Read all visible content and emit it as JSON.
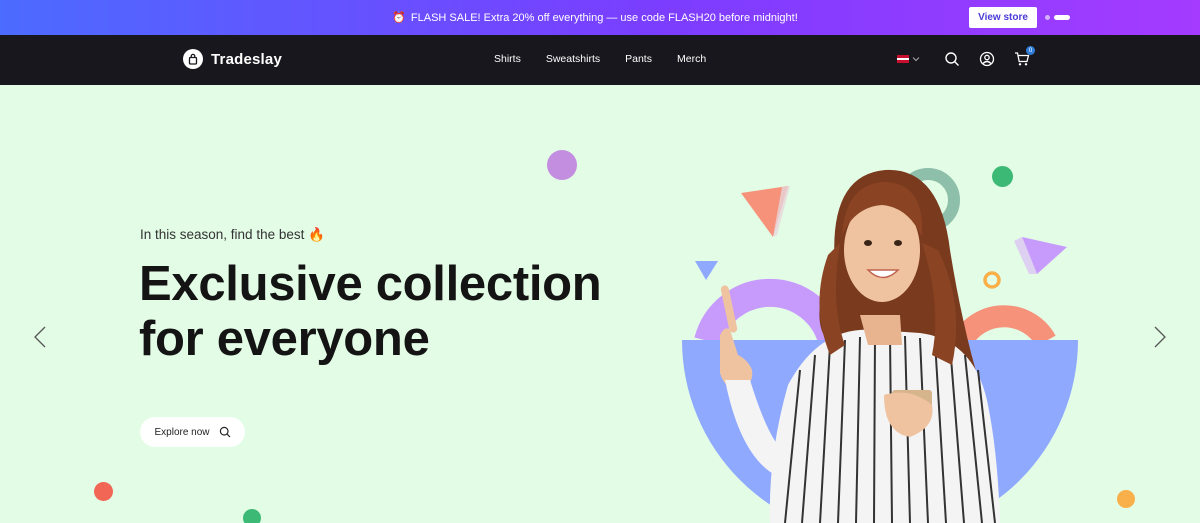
{
  "announcement": {
    "message": "FLASH SALE! Extra 20% off everything — use code FLASH20 before midnight!",
    "cta": "View store"
  },
  "header": {
    "brand": "Tradeslay",
    "nav": [
      "Shirts",
      "Sweatshirts",
      "Pants",
      "Merch"
    ],
    "cart_count": "0"
  },
  "hero": {
    "subtitle": "In this season, find the best 🔥",
    "headline_line1": "Exclusive collection",
    "headline_line2": "for everyone",
    "cta": "Explore now"
  },
  "colors": {
    "announcement_gradient_start": "#4c6bff",
    "announcement_gradient_end": "#a43bff",
    "header_bg": "#17171d",
    "hero_bg": "#e3fce6",
    "accent_blue": "#8fa9ff",
    "accent_purple": "#c79bfb",
    "accent_coral": "#f7927a",
    "accent_green": "#3cba75"
  },
  "icons": [
    "clock-icon",
    "logo-bag-icon",
    "flag-icon",
    "chevron-down-icon",
    "search-icon",
    "user-icon",
    "cart-icon",
    "arrow-left-icon",
    "arrow-right-icon"
  ]
}
